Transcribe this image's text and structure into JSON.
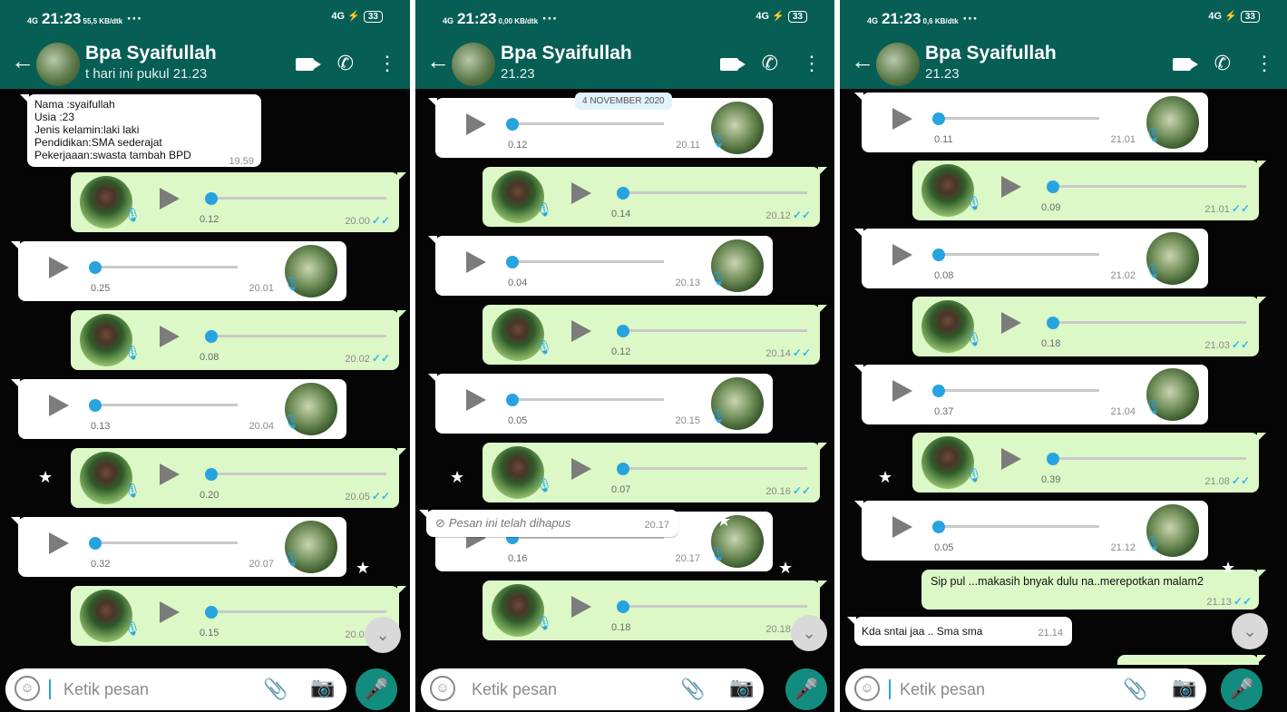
{
  "panels": [
    {
      "status": {
        "time": "21:23",
        "speed": "55,5 KB/dtk",
        "network": "4G",
        "battery": "33"
      },
      "header": {
        "name": "Bpa Syaifullah",
        "subtitle": "t hari ini pukul 21.23"
      },
      "profile_text": [
        "Nama :syaifullah",
        "Usia :23",
        "Jenis kelamin:laki laki",
        "Pendidikan:SMA sederajat",
        "Pekerjaaan:swasta tambah BPD"
      ],
      "profile_time": "19.59",
      "voice": [
        {
          "dir": "out",
          "dur": "0.12",
          "time": "20.00"
        },
        {
          "dir": "in",
          "dur": "0.25",
          "time": "20.01"
        },
        {
          "dir": "out",
          "dur": "0.08",
          "time": "20.02"
        },
        {
          "dir": "in",
          "dur": "0.13",
          "time": "20.04"
        },
        {
          "dir": "out",
          "dur": "0.20",
          "time": "20.05"
        },
        {
          "dir": "in",
          "dur": "0.32",
          "time": "20.07"
        },
        {
          "dir": "out",
          "dur": "0.15",
          "time": "20.08"
        }
      ],
      "input": {
        "placeholder": "Ketik pesan"
      }
    },
    {
      "status": {
        "time": "21:23",
        "speed": "0,00 KB/dtk",
        "network": "4G",
        "battery": "33"
      },
      "header": {
        "name": "Bpa Syaifullah",
        "subtitle": "21.23"
      },
      "date_chip": "4 NOVEMBER 2020",
      "voice": [
        {
          "dir": "in",
          "dur": "0.12",
          "time": "20.11"
        },
        {
          "dir": "out",
          "dur": "0.14",
          "time": "20.12"
        },
        {
          "dir": "in",
          "dur": "0.04",
          "time": "20.13"
        },
        {
          "dir": "out",
          "dur": "0.12",
          "time": "20.14"
        },
        {
          "dir": "in",
          "dur": "0.05",
          "time": "20.15"
        },
        {
          "dir": "out",
          "dur": "0.07",
          "time": "20.16"
        },
        {
          "dir": "in",
          "dur": "0.16",
          "time": "20.17"
        },
        {
          "dir": "out",
          "dur": "0.18",
          "time": "20.18"
        }
      ],
      "deleted": {
        "text": "Pesan ini telah dihapus",
        "time": "20.17"
      },
      "input": {
        "placeholder": "Ketik pesan"
      }
    },
    {
      "status": {
        "time": "21:23",
        "speed": "0,6 KB/dtk",
        "network": "4G",
        "battery": "33"
      },
      "header": {
        "name": "Bpa Syaifullah",
        "subtitle": "21.23"
      },
      "voice": [
        {
          "dir": "in",
          "dur": "0.11",
          "time": "21.01"
        },
        {
          "dir": "out",
          "dur": "0.09",
          "time": "21.01"
        },
        {
          "dir": "in",
          "dur": "0.08",
          "time": "21.02"
        },
        {
          "dir": "out",
          "dur": "0.18",
          "time": "21.03"
        },
        {
          "dir": "in",
          "dur": "0.37",
          "time": "21.04"
        },
        {
          "dir": "out",
          "dur": "0.39",
          "time": "21.08"
        },
        {
          "dir": "in",
          "dur": "0.05",
          "time": "21.12"
        }
      ],
      "texts": [
        {
          "dir": "out",
          "text": "Sip pul ...makasih bnyak dulu na..merepotkan malam2",
          "time": "21.13"
        },
        {
          "dir": "in",
          "text": "Kda sntai jaa .. Sma sma",
          "time": "21.14"
        }
      ],
      "input": {
        "placeholder": "Ketik pesan"
      }
    }
  ]
}
